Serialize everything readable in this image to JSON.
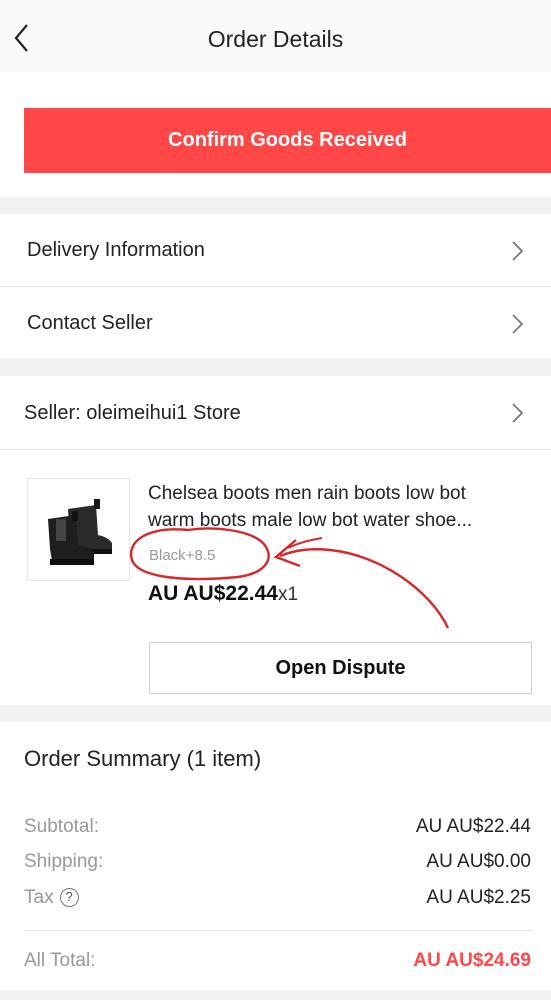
{
  "header": {
    "title": "Order Details"
  },
  "actions": {
    "confirm_label": "Confirm Goods Received"
  },
  "menu": {
    "delivery_label": "Delivery Information",
    "contact_label": "Contact Seller"
  },
  "seller": {
    "label": "Seller: oleimeihui1 Store"
  },
  "product": {
    "title_line1": "Chelsea boots men rain boots low bot",
    "title_line2": "warm boots male low bot water shoe...",
    "sku": "Black+8.5",
    "price": "AU AU$22.44",
    "quantity": "x1",
    "dispute_label": "Open Dispute",
    "image_icon": "black-chelsea-boots-photo"
  },
  "summary": {
    "title": "Order Summary (1 item)",
    "subtotal_label": "Subtotal:",
    "subtotal_value": "AU AU$22.44",
    "shipping_label": "Shipping:",
    "shipping_value": "AU AU$0.00",
    "tax_label": "Tax",
    "tax_help_glyph": "?",
    "tax_value": "AU AU$2.25",
    "total_label": "All Total:",
    "total_value": "AU AU$24.69"
  },
  "colors": {
    "accent": "#ff4747",
    "annotation": "#d9262b"
  }
}
